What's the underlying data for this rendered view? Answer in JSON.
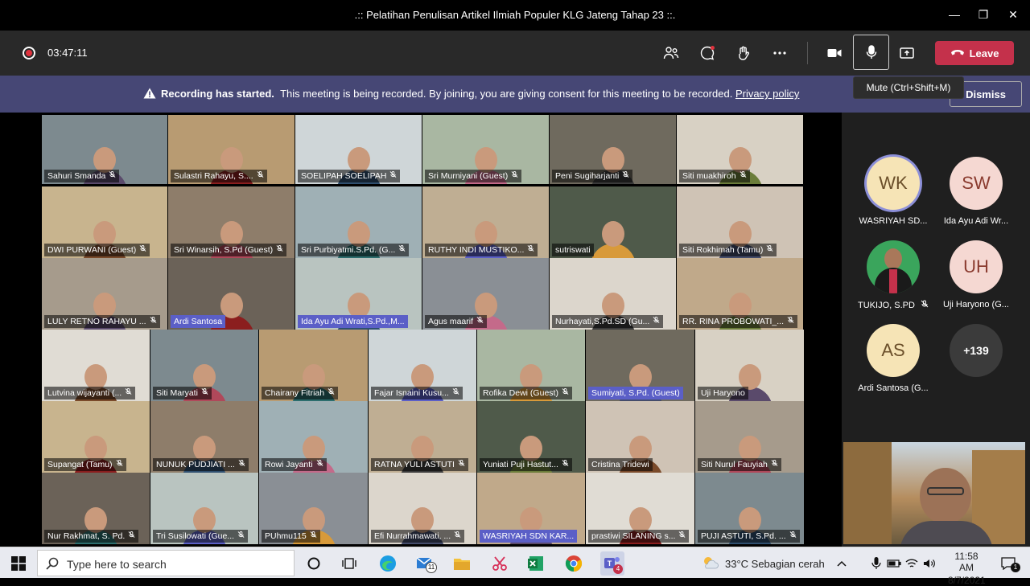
{
  "window": {
    "title": ".:: Pelatihan Penulisan Artikel Ilmiah Populer KLG Jateng Tahap 23 ::."
  },
  "toolbar": {
    "timer": "03:47:11",
    "leave_label": "Leave",
    "mic_tooltip": "Mute (Ctrl+Shift+M)"
  },
  "banner": {
    "bold": "Recording has started.",
    "text": "This meeting is being recorded. By joining, you are giving consent for this meeting to be recorded.",
    "link": "Privacy policy",
    "dismiss": "Dismiss"
  },
  "tiles": [
    {
      "name": "Sahuri Smanda"
    },
    {
      "name": "Sulastri Rahayu, S...."
    },
    {
      "name": "SOELIPAH SOELIPAH"
    },
    {
      "name": "Sri Murniyani (Guest)"
    },
    {
      "name": "Peni Sugiharjanti"
    },
    {
      "name": "Siti muakhiroh"
    },
    {
      "name": "DWI PURWANI (Guest)"
    },
    {
      "name": "Sri Winarsih, S.Pd (Guest)"
    },
    {
      "name": "Sri Purbiyatmi.S.Pd. (G..."
    },
    {
      "name": "RUTHY INDI MUSTIKO..."
    },
    {
      "name": "sutriswati"
    },
    {
      "name": "Siti Rokhimah (Tamu)"
    },
    {
      "name": "LULY RETNO RAHAYU ..."
    },
    {
      "name": "Ardi Santosa"
    },
    {
      "name": "Ida Ayu Adi Wrati,S.Pd.,M..."
    },
    {
      "name": "Agus maarif"
    },
    {
      "name": "Nurhayati,S.Pd.SD (Gu..."
    },
    {
      "name": "RR. RINA PROBOWATI_..."
    },
    {
      "name": "Lutvina wijayanti (..."
    },
    {
      "name": "Siti Maryati"
    },
    {
      "name": "Chairany Fitriah"
    },
    {
      "name": "Fajar Isnaini Kusu..."
    },
    {
      "name": "Rofika Dewi (Guest)"
    },
    {
      "name": "Sumiyati, S.Pd. (Guest)"
    },
    {
      "name": "Uji Haryono"
    },
    {
      "name": "Supangat (Tamu)"
    },
    {
      "name": "NUNUK PUDJIATI ..."
    },
    {
      "name": "Rowi Jayanti"
    },
    {
      "name": "RATNA YULI ASTUTI"
    },
    {
      "name": "Yuniati Puji Hastut..."
    },
    {
      "name": "Cristina Tridewi"
    },
    {
      "name": "Siti Nurul Fauyiah"
    },
    {
      "name": "Nur Rakhmat, S. Pd."
    },
    {
      "name": "Tri Susilowati (Gue..."
    },
    {
      "name": "PUhmu115"
    },
    {
      "name": "Efi Nurrahmawati, ..."
    },
    {
      "name": "WASRIYAH SDN KAR..."
    },
    {
      "name": "prastiwi SILANING s..."
    },
    {
      "name": "PUJI ASTUTI, S.Pd. ..."
    }
  ],
  "side_avatars": [
    {
      "initials": "WK",
      "name": "WASRIYAH SD..."
    },
    {
      "initials": "SW",
      "name": "Ida Ayu Adi Wr..."
    },
    {
      "initials": "",
      "name": "TUKIJO, S.PD"
    },
    {
      "initials": "UH",
      "name": "Uji Haryono (G..."
    },
    {
      "initials": "AS",
      "name": "Ardi Santosa (G..."
    },
    {
      "initials": "+139",
      "name": ""
    }
  ],
  "taskbar": {
    "search_placeholder": "Type here to search",
    "mail_badge": "11",
    "teams_badge": "4",
    "weather": "33°C  Sebagian cerah",
    "time": "11:58 AM",
    "date": "8/7/2021",
    "notif_count": "1"
  }
}
